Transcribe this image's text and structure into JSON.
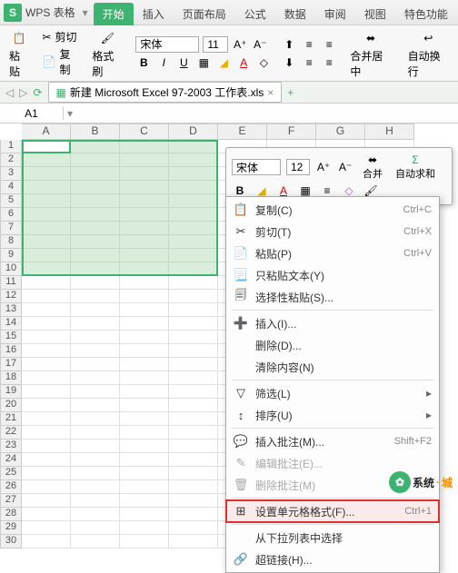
{
  "app": {
    "name": "WPS 表格",
    "logo": "S"
  },
  "tabs": [
    "开始",
    "插入",
    "页面布局",
    "公式",
    "数据",
    "审阅",
    "视图",
    "特色功能"
  ],
  "active_tab": 0,
  "ribbon": {
    "paste": "粘贴",
    "cut": "剪切",
    "copy": "复制",
    "format_painter": "格式刷",
    "font_name": "宋体",
    "font_size": "11",
    "merge": "合并居中",
    "wrap": "自动换行"
  },
  "doc": {
    "title": "新建 Microsoft Excel 97-2003 工作表.xls"
  },
  "namebox": "A1",
  "columns": [
    "A",
    "B",
    "C",
    "D",
    "E",
    "F",
    "G",
    "H"
  ],
  "rows": 30,
  "mini_toolbar": {
    "font_name": "宋体",
    "font_size": "12",
    "merge": "合并",
    "autosum": "自动求和"
  },
  "context_menu": [
    {
      "icon": "📋",
      "label": "复制(C)",
      "shortcut": "Ctrl+C"
    },
    {
      "icon": "✂",
      "label": "剪切(T)",
      "shortcut": "Ctrl+X"
    },
    {
      "icon": "📄",
      "label": "粘贴(P)",
      "shortcut": "Ctrl+V"
    },
    {
      "icon": "📃",
      "label": "只粘贴文本(Y)",
      "shortcut": ""
    },
    {
      "icon": "🗐",
      "label": "选择性粘贴(S)...",
      "shortcut": ""
    },
    {
      "sep": true
    },
    {
      "icon": "➕",
      "label": "插入(I)...",
      "shortcut": ""
    },
    {
      "icon": "",
      "label": "删除(D)...",
      "shortcut": ""
    },
    {
      "icon": "",
      "label": "清除内容(N)",
      "shortcut": ""
    },
    {
      "sep": true
    },
    {
      "icon": "▽",
      "label": "筛选(L)",
      "shortcut": "",
      "submenu": true
    },
    {
      "icon": "↕",
      "label": "排序(U)",
      "shortcut": "",
      "submenu": true
    },
    {
      "sep": true
    },
    {
      "icon": "💬",
      "label": "插入批注(M)...",
      "shortcut": "Shift+F2"
    },
    {
      "icon": "✎",
      "label": "编辑批注(E)...",
      "shortcut": "",
      "disabled": true
    },
    {
      "icon": "🗑",
      "label": "删除批注(M)",
      "shortcut": "",
      "disabled": true
    },
    {
      "sep": true
    },
    {
      "icon": "⊞",
      "label": "设置单元格格式(F)...",
      "shortcut": "Ctrl+1",
      "highlighted": true
    },
    {
      "sep": true
    },
    {
      "icon": "",
      "label": "从下拉列表中选择",
      "shortcut": ""
    },
    {
      "icon": "🔗",
      "label": "超链接(H)...",
      "shortcut": ""
    }
  ],
  "watermark": {
    "text1": "系统",
    "text2": "城"
  }
}
